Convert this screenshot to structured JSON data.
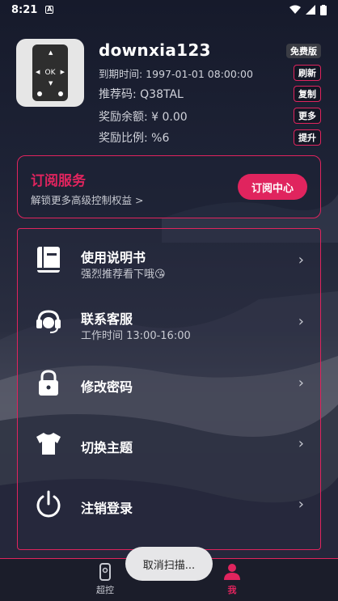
{
  "status_bar": {
    "time": "8:21"
  },
  "profile": {
    "username": "downxia123",
    "expire": "到期时间: 1997-01-01 08:00:00",
    "referral": "推荐码: Q38TAL",
    "balance": "奖励余额: ¥ 0.00",
    "ratio": "奖励比例: %6",
    "tags": {
      "plan": "免费版",
      "refresh": "刷新",
      "copy": "复制",
      "more": "更多",
      "upgrade": "提升"
    }
  },
  "subscribe": {
    "title": "订阅服务",
    "desc": "解锁更多高级控制权益 >",
    "button": "订阅中心"
  },
  "menu": {
    "items": [
      {
        "label": "使用说明书",
        "sub": "强烈推荐看下哦😘",
        "icon": "book-icon"
      },
      {
        "label": "联系客服",
        "sub": "工作时间 13:00-16:00",
        "icon": "headset-icon"
      },
      {
        "label": "修改密码",
        "sub": "",
        "icon": "lock-icon"
      },
      {
        "label": "切换主题",
        "sub": "",
        "icon": "shirt-icon"
      },
      {
        "label": "注销登录",
        "sub": "",
        "icon": "power-icon"
      }
    ]
  },
  "tabbar": {
    "control": "超控",
    "me": "我"
  },
  "toast": "取消扫描...",
  "colors": {
    "accent": "#e0245e",
    "background": "#1c2030"
  }
}
